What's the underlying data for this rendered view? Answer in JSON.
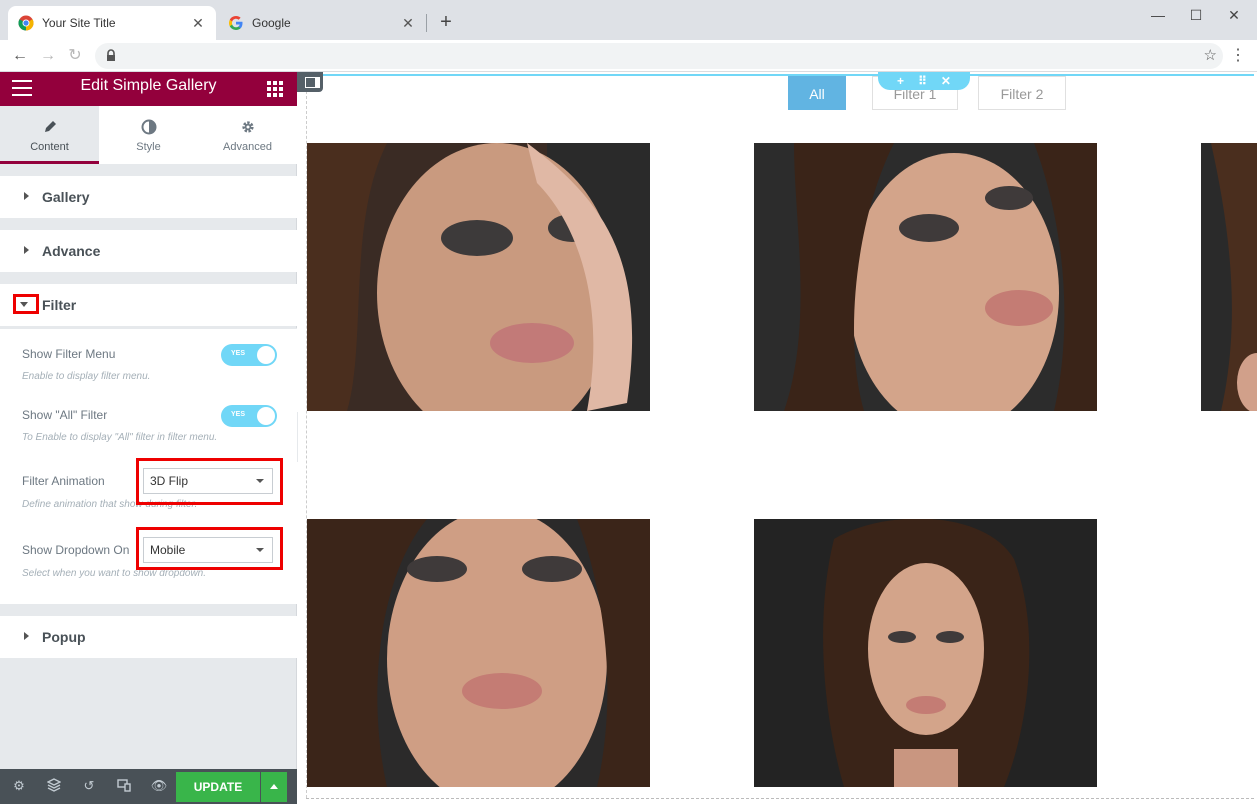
{
  "browser": {
    "tabs": [
      {
        "title": "Your Site Title",
        "active": true
      },
      {
        "title": "Google",
        "active": false
      }
    ],
    "url": ""
  },
  "panel": {
    "title": "Edit Simple Gallery",
    "tabs": [
      {
        "label": "Content",
        "icon": "pencil-icon"
      },
      {
        "label": "Style",
        "icon": "contrast-icon"
      },
      {
        "label": "Advanced",
        "icon": "gear-icon"
      }
    ],
    "sections": {
      "gallery": "Gallery",
      "advance": "Advance",
      "filter": "Filter",
      "popup": "Popup"
    },
    "filter": {
      "show_filter_menu": {
        "label": "Show Filter Menu",
        "desc": "Enable to display filter menu.",
        "switch_text": "YES",
        "on": true
      },
      "show_all_filter": {
        "label": "Show \"All\" Filter",
        "desc": "To Enable to display \"All\" filter in filter menu.",
        "switch_text": "YES",
        "on": true
      },
      "filter_animation": {
        "label": "Filter Animation",
        "value": "3D Flip",
        "desc": "Define animation that show during filter."
      },
      "show_dropdown_on": {
        "label": "Show Dropdown On",
        "value": "Mobile",
        "desc": "Select when you want to show dropdown."
      }
    },
    "footer": {
      "update_label": "UPDATE"
    },
    "colors": {
      "header": "#93003c",
      "switch": "#71d7f7",
      "update": "#39b54a",
      "highlight": "#e00000"
    }
  },
  "preview": {
    "filters": [
      "All",
      "Filter 1",
      "Filter 2"
    ],
    "active_filter": "All",
    "gallery_items": [
      {
        "description": "portrait"
      },
      {
        "description": "portrait"
      },
      {
        "description": "portrait"
      },
      {
        "description": "portrait"
      },
      {
        "description": "portrait"
      }
    ]
  }
}
